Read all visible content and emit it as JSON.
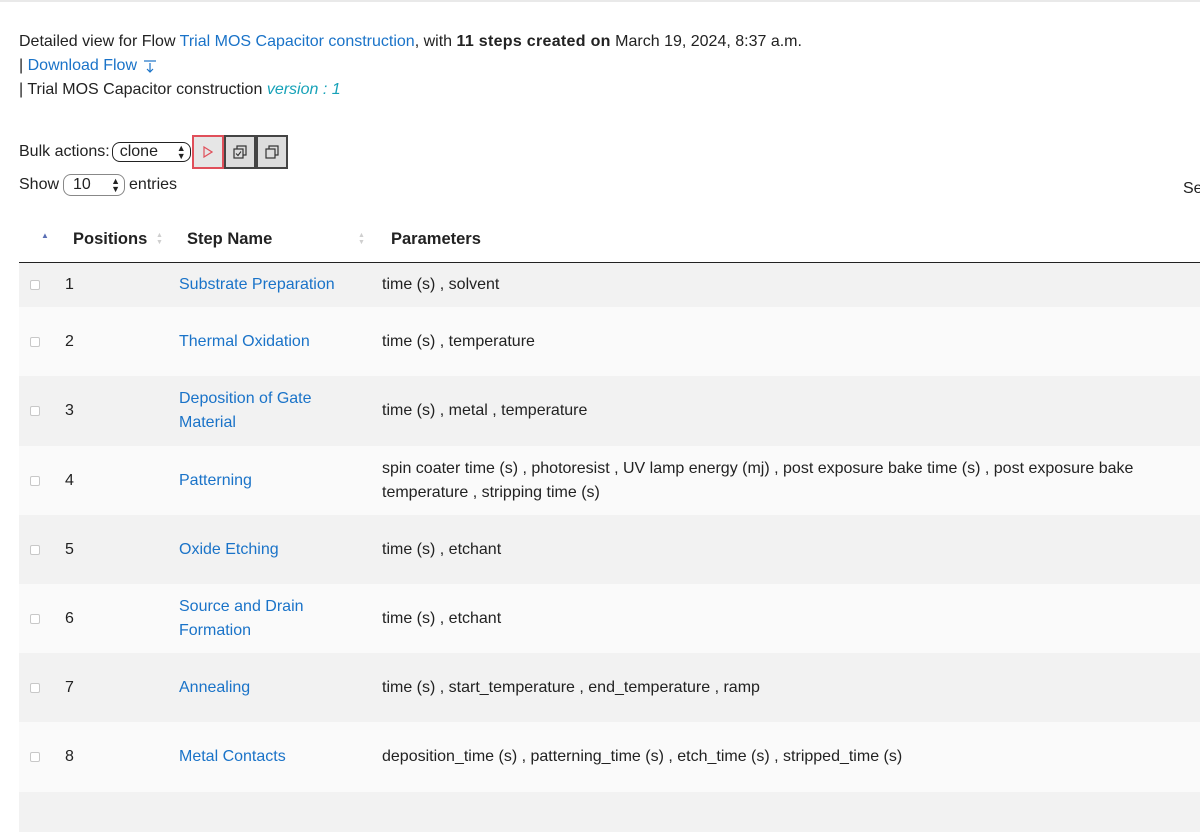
{
  "header": {
    "prefix": "Detailed view for Flow ",
    "flow_name": "Trial MOS Capacitor construction",
    "with_text": ", with ",
    "steps_created": "11 steps created on",
    "created_at": " March 19, 2024, 8:37 a.m.",
    "bar1": "| ",
    "download_label": "Download Flow",
    "bar2": "| ",
    "flow_title": "Trial MOS Capacitor construction",
    "version_label": "version : 1"
  },
  "bulk": {
    "label": "Bulk actions:",
    "selected_action": "clone"
  },
  "length": {
    "show_label": "Show",
    "value": "10",
    "entries_label": "entries"
  },
  "search": {
    "label_partial": "Se"
  },
  "table": {
    "columns": [
      "Positions",
      "Step Name",
      "Parameters"
    ],
    "rows": [
      {
        "position": "1",
        "name": "Substrate Preparation",
        "params": "time (s) , solvent"
      },
      {
        "position": "2",
        "name": "Thermal Oxidation",
        "params": "time (s) , temperature"
      },
      {
        "position": "3",
        "name": "Deposition of Gate Material",
        "params": "time (s) , metal , temperature"
      },
      {
        "position": "4",
        "name": "Patterning",
        "params": "spin coater time (s) , photoresist , UV lamp energy (mj) , post exposure bake time (s) , post exposure bake temperature , stripping time (s)"
      },
      {
        "position": "5",
        "name": "Oxide Etching",
        "params": "time (s) , etchant"
      },
      {
        "position": "6",
        "name": "Source and Drain Formation",
        "params": "time (s) , etchant"
      },
      {
        "position": "7",
        "name": "Annealing",
        "params": "time (s) , start_temperature , end_temperature , ramp"
      },
      {
        "position": "8",
        "name": "Metal Contacts",
        "params": "deposition_time (s) , patterning_time (s) , etch_time (s) , stripped_time (s)"
      }
    ]
  },
  "colors": {
    "link": "#1a73c8",
    "version": "#17a2b8",
    "run_border": "#e04f5a"
  }
}
